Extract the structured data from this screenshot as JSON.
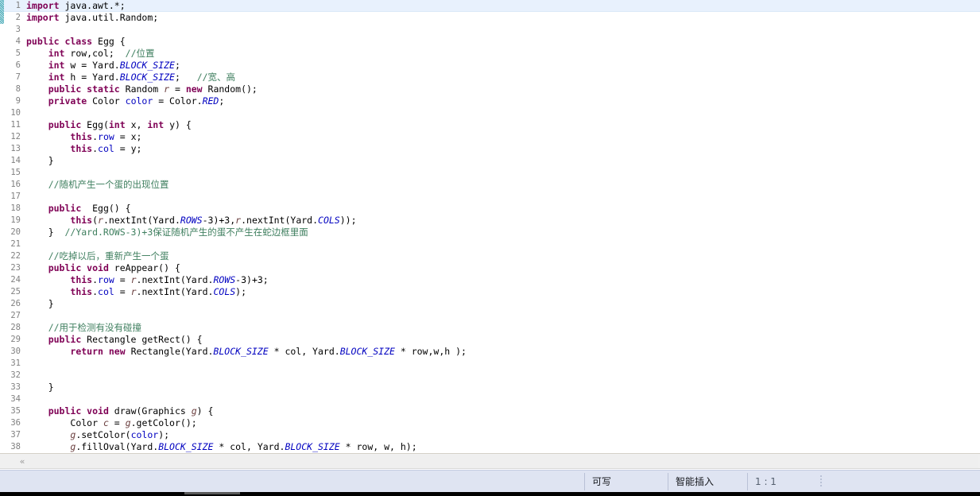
{
  "editor": {
    "language": "Java",
    "current_line": 1,
    "lines": [
      {
        "n": 1,
        "tokens": [
          {
            "t": "kw",
            "v": "import"
          },
          {
            "t": "pun",
            "v": " java.awt.*;"
          }
        ]
      },
      {
        "n": 2,
        "tokens": [
          {
            "t": "kw",
            "v": "import"
          },
          {
            "t": "pun",
            "v": " java.util.Random;"
          }
        ]
      },
      {
        "n": 3,
        "tokens": []
      },
      {
        "n": 4,
        "tokens": [
          {
            "t": "kw",
            "v": "public class"
          },
          {
            "t": "pun",
            "v": " Egg {"
          }
        ]
      },
      {
        "n": 5,
        "tokens": [
          {
            "t": "pun",
            "v": "    "
          },
          {
            "t": "kw",
            "v": "int"
          },
          {
            "t": "pun",
            "v": " row,col;  "
          },
          {
            "t": "cmt",
            "v": "//位置"
          }
        ]
      },
      {
        "n": 6,
        "tokens": [
          {
            "t": "pun",
            "v": "    "
          },
          {
            "t": "kw",
            "v": "int"
          },
          {
            "t": "pun",
            "v": " w = Yard."
          },
          {
            "t": "sfld",
            "v": "BLOCK_SIZE"
          },
          {
            "t": "pun",
            "v": ";"
          }
        ]
      },
      {
        "n": 7,
        "tokens": [
          {
            "t": "pun",
            "v": "    "
          },
          {
            "t": "kw",
            "v": "int"
          },
          {
            "t": "pun",
            "v": " h = Yard."
          },
          {
            "t": "sfld",
            "v": "BLOCK_SIZE"
          },
          {
            "t": "pun",
            "v": ";   "
          },
          {
            "t": "cmt",
            "v": "//宽、高"
          }
        ]
      },
      {
        "n": 8,
        "tokens": [
          {
            "t": "pun",
            "v": "    "
          },
          {
            "t": "kw",
            "v": "public static"
          },
          {
            "t": "pun",
            "v": " Random "
          },
          {
            "t": "loc",
            "v": "r"
          },
          {
            "t": "pun",
            "v": " = "
          },
          {
            "t": "kw",
            "v": "new"
          },
          {
            "t": "pun",
            "v": " Random();"
          }
        ]
      },
      {
        "n": 9,
        "tokens": [
          {
            "t": "pun",
            "v": "    "
          },
          {
            "t": "kw",
            "v": "private"
          },
          {
            "t": "pun",
            "v": " Color "
          },
          {
            "t": "fld",
            "v": "color"
          },
          {
            "t": "pun",
            "v": " = Color."
          },
          {
            "t": "sfld",
            "v": "RED"
          },
          {
            "t": "pun",
            "v": ";"
          }
        ]
      },
      {
        "n": 10,
        "tokens": []
      },
      {
        "n": 11,
        "tokens": [
          {
            "t": "pun",
            "v": "    "
          },
          {
            "t": "kw",
            "v": "public"
          },
          {
            "t": "pun",
            "v": " Egg("
          },
          {
            "t": "kw",
            "v": "int"
          },
          {
            "t": "pun",
            "v": " x, "
          },
          {
            "t": "kw",
            "v": "int"
          },
          {
            "t": "pun",
            "v": " y) {"
          }
        ]
      },
      {
        "n": 12,
        "tokens": [
          {
            "t": "pun",
            "v": "        "
          },
          {
            "t": "kw",
            "v": "this"
          },
          {
            "t": "pun",
            "v": "."
          },
          {
            "t": "fld",
            "v": "row"
          },
          {
            "t": "pun",
            "v": " = x;"
          }
        ]
      },
      {
        "n": 13,
        "tokens": [
          {
            "t": "pun",
            "v": "        "
          },
          {
            "t": "kw",
            "v": "this"
          },
          {
            "t": "pun",
            "v": "."
          },
          {
            "t": "fld",
            "v": "col"
          },
          {
            "t": "pun",
            "v": " = y;"
          }
        ]
      },
      {
        "n": 14,
        "tokens": [
          {
            "t": "pun",
            "v": "    }"
          }
        ]
      },
      {
        "n": 15,
        "tokens": []
      },
      {
        "n": 16,
        "tokens": [
          {
            "t": "pun",
            "v": "    "
          },
          {
            "t": "cmt",
            "v": "//随机产生一个蛋的出现位置"
          }
        ]
      },
      {
        "n": 17,
        "tokens": []
      },
      {
        "n": 18,
        "tokens": [
          {
            "t": "pun",
            "v": "    "
          },
          {
            "t": "kw",
            "v": "public"
          },
          {
            "t": "pun",
            "v": "  Egg() {"
          }
        ]
      },
      {
        "n": 19,
        "tokens": [
          {
            "t": "pun",
            "v": "        "
          },
          {
            "t": "kw",
            "v": "this"
          },
          {
            "t": "pun",
            "v": "("
          },
          {
            "t": "loc",
            "v": "r"
          },
          {
            "t": "pun",
            "v": ".nextInt(Yard."
          },
          {
            "t": "sfld",
            "v": "ROWS"
          },
          {
            "t": "pun",
            "v": "-3)+3,"
          },
          {
            "t": "loc",
            "v": "r"
          },
          {
            "t": "pun",
            "v": ".nextInt(Yard."
          },
          {
            "t": "sfld",
            "v": "COLS"
          },
          {
            "t": "pun",
            "v": "));"
          }
        ]
      },
      {
        "n": 20,
        "tokens": [
          {
            "t": "pun",
            "v": "    }  "
          },
          {
            "t": "cmt",
            "v": "//Yard.ROWS-3)+3保证随机产生的蛋不产生在蛇边框里面"
          }
        ]
      },
      {
        "n": 21,
        "tokens": []
      },
      {
        "n": 22,
        "tokens": [
          {
            "t": "pun",
            "v": "    "
          },
          {
            "t": "cmt",
            "v": "//吃掉以后，重新产生一个蛋"
          }
        ]
      },
      {
        "n": 23,
        "tokens": [
          {
            "t": "pun",
            "v": "    "
          },
          {
            "t": "kw",
            "v": "public void"
          },
          {
            "t": "pun",
            "v": " reAppear() {"
          }
        ]
      },
      {
        "n": 24,
        "tokens": [
          {
            "t": "pun",
            "v": "        "
          },
          {
            "t": "kw",
            "v": "this"
          },
          {
            "t": "pun",
            "v": "."
          },
          {
            "t": "fld",
            "v": "row"
          },
          {
            "t": "pun",
            "v": " = "
          },
          {
            "t": "loc",
            "v": "r"
          },
          {
            "t": "pun",
            "v": ".nextInt(Yard."
          },
          {
            "t": "sfld",
            "v": "ROWS"
          },
          {
            "t": "pun",
            "v": "-3)+3;"
          }
        ]
      },
      {
        "n": 25,
        "tokens": [
          {
            "t": "pun",
            "v": "        "
          },
          {
            "t": "kw",
            "v": "this"
          },
          {
            "t": "pun",
            "v": "."
          },
          {
            "t": "fld",
            "v": "col"
          },
          {
            "t": "pun",
            "v": " = "
          },
          {
            "t": "loc",
            "v": "r"
          },
          {
            "t": "pun",
            "v": ".nextInt(Yard."
          },
          {
            "t": "sfld",
            "v": "COLS"
          },
          {
            "t": "pun",
            "v": ");"
          }
        ]
      },
      {
        "n": 26,
        "tokens": [
          {
            "t": "pun",
            "v": "    }"
          }
        ]
      },
      {
        "n": 27,
        "tokens": []
      },
      {
        "n": 28,
        "tokens": [
          {
            "t": "pun",
            "v": "    "
          },
          {
            "t": "cmt",
            "v": "//用于检测有没有碰撞"
          }
        ]
      },
      {
        "n": 29,
        "tokens": [
          {
            "t": "pun",
            "v": "    "
          },
          {
            "t": "kw",
            "v": "public"
          },
          {
            "t": "pun",
            "v": " Rectangle getRect() {"
          }
        ]
      },
      {
        "n": 30,
        "tokens": [
          {
            "t": "pun",
            "v": "        "
          },
          {
            "t": "kw",
            "v": "return new"
          },
          {
            "t": "pun",
            "v": " Rectangle(Yard."
          },
          {
            "t": "sfld",
            "v": "BLOCK_SIZE"
          },
          {
            "t": "pun",
            "v": " * col, Yard."
          },
          {
            "t": "sfld",
            "v": "BLOCK_SIZE"
          },
          {
            "t": "pun",
            "v": " * row,w,h );"
          }
        ]
      },
      {
        "n": 31,
        "tokens": []
      },
      {
        "n": 32,
        "tokens": []
      },
      {
        "n": 33,
        "tokens": [
          {
            "t": "pun",
            "v": "    }"
          }
        ]
      },
      {
        "n": 34,
        "tokens": []
      },
      {
        "n": 35,
        "tokens": [
          {
            "t": "pun",
            "v": "    "
          },
          {
            "t": "kw",
            "v": "public void"
          },
          {
            "t": "pun",
            "v": " draw(Graphics "
          },
          {
            "t": "loc",
            "v": "g"
          },
          {
            "t": "pun",
            "v": ") {"
          }
        ]
      },
      {
        "n": 36,
        "tokens": [
          {
            "t": "pun",
            "v": "        "
          },
          {
            "t": "pun",
            "v": "Color "
          },
          {
            "t": "loc",
            "v": "c"
          },
          {
            "t": "pun",
            "v": " = "
          },
          {
            "t": "loc",
            "v": "g"
          },
          {
            "t": "pun",
            "v": ".getColor();"
          }
        ]
      },
      {
        "n": 37,
        "tokens": [
          {
            "t": "pun",
            "v": "        "
          },
          {
            "t": "loc",
            "v": "g"
          },
          {
            "t": "pun",
            "v": ".setColor("
          },
          {
            "t": "fld",
            "v": "color"
          },
          {
            "t": "pun",
            "v": ");"
          }
        ]
      },
      {
        "n": 38,
        "tokens": [
          {
            "t": "pun",
            "v": "        "
          },
          {
            "t": "loc",
            "v": "g"
          },
          {
            "t": "pun",
            "v": ".fillOval(Yard."
          },
          {
            "t": "sfld",
            "v": "BLOCK_SIZE"
          },
          {
            "t": "pun",
            "v": " * col, Yard."
          },
          {
            "t": "sfld",
            "v": "BLOCK_SIZE"
          },
          {
            "t": "pun",
            "v": " * row, w, h);"
          }
        ]
      }
    ]
  },
  "scrollbar": {
    "left_arrow_glyph": "«"
  },
  "status_bar": {
    "writable": "可写",
    "insert_mode": "智能插入",
    "cursor_position": "1 : 1"
  },
  "colors": {
    "keyword": "#7f0055",
    "comment": "#3f7f5f",
    "field": "#0000c0",
    "static_field": "#0000c0",
    "local_var": "#6a3e3e",
    "line_number": "#808080",
    "current_line_highlight": "#e8f1fd",
    "status_bar_bg": "#dfe4f2",
    "change_bar": "#2a9aa8"
  }
}
